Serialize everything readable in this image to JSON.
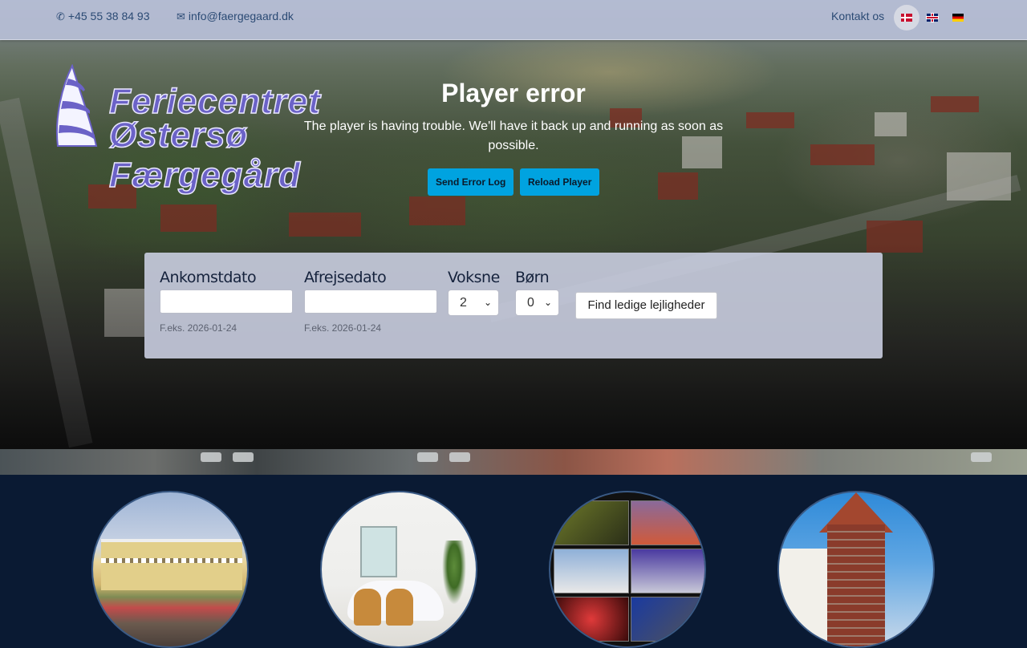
{
  "topbar": {
    "phone": "+45 55 38 84 93",
    "email": "info@faergegaard.dk",
    "kontakt": "Kontakt os",
    "languages": [
      {
        "code": "da",
        "icon": "danish-flag-icon",
        "active": true
      },
      {
        "code": "en",
        "icon": "british-flag-icon",
        "active": false
      },
      {
        "code": "de",
        "icon": "german-flag-icon",
        "active": false
      }
    ]
  },
  "logo": {
    "line1": "Feriecentret",
    "line2": "Østersø Færgegård"
  },
  "player_error": {
    "title": "Player error",
    "message": "The player is having trouble. We'll have it back up and running as soon as possible.",
    "send_log": "Send Error Log",
    "reload": "Reload Player"
  },
  "booking": {
    "arrival_label": "Ankomstdato",
    "arrival_value": "",
    "arrival_hint": "F.eks. 2026-01-24",
    "departure_label": "Afrejsedato",
    "departure_value": "",
    "departure_hint": "F.eks. 2026-01-24",
    "adults_label": "Voksne",
    "adults_value": "2",
    "children_label": "Børn",
    "children_value": "0",
    "submit": "Find ledige lejligheder"
  },
  "colors": {
    "topbar_bg": "#b7bed6",
    "text_blue": "#2b4a74",
    "error_button": "#00a3e0",
    "footer_bg": "#0a1a33",
    "logo_purple": "#6b62c7"
  }
}
